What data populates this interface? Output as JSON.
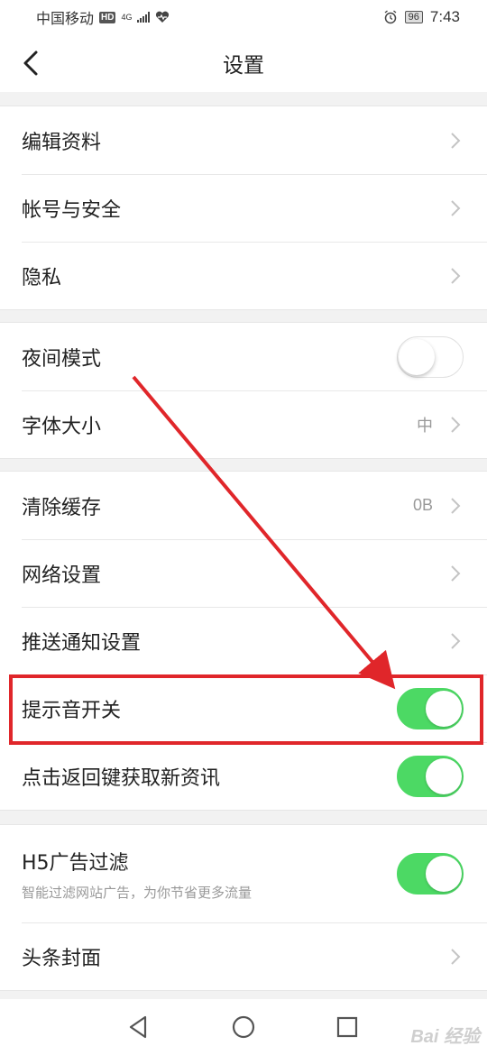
{
  "status_bar": {
    "carrier": "中国移动",
    "hd_badge": "HD",
    "network_type": "4G",
    "battery": "96",
    "time": "7:43"
  },
  "header": {
    "title": "设置",
    "back_icon": "chevron-left-icon"
  },
  "groups": [
    {
      "rows": [
        {
          "label": "编辑资料"
        },
        {
          "label": "帐号与安全"
        },
        {
          "label": "隐私"
        }
      ]
    },
    {
      "rows": [
        {
          "label": "夜间模式",
          "toggle": false
        },
        {
          "label": "字体大小",
          "value": "中"
        }
      ]
    },
    {
      "rows": [
        {
          "label": "清除缓存",
          "value": "0B"
        },
        {
          "label": "网络设置"
        },
        {
          "label": "推送通知设置"
        },
        {
          "label": "提示音开关",
          "toggle": true
        },
        {
          "label": "点击返回键获取新资讯",
          "toggle": true
        }
      ]
    },
    {
      "rows": [
        {
          "label": "H5广告过滤",
          "sublabel": "智能过滤网站广告，为你节省更多流量",
          "toggle": true
        },
        {
          "label": "头条封面"
        }
      ]
    }
  ],
  "annotation": {
    "highlight_color": "#e0262a",
    "arrow_color": "#e0262a"
  },
  "colors": {
    "toggle_on": "#4cd964",
    "background": "#f2f2f2"
  },
  "nav_bar": {
    "back_icon": "triangle-back-icon",
    "home_icon": "circle-home-icon",
    "recents_icon": "square-recents-icon"
  },
  "watermark": "Bai 经验"
}
